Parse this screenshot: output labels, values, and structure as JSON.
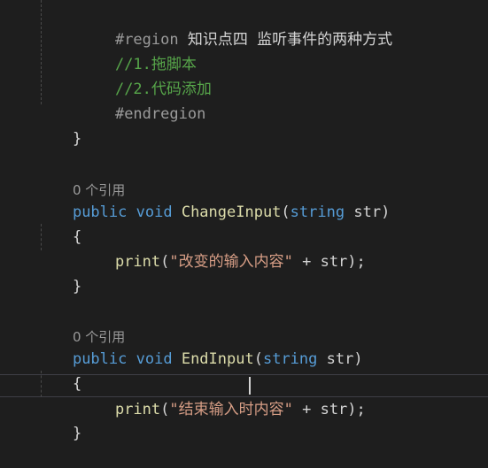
{
  "lines": {
    "region_start": {
      "directive": "#region",
      "title": "知识点四 监听事件的两种方式"
    },
    "comment_1": "//1.拖脚本",
    "comment_2": "//2.代码添加",
    "region_end": "#endregion",
    "close_brace_1": "}",
    "method1": {
      "refs": "0 个引用",
      "kw_public": "public",
      "kw_void": "void",
      "name": "ChangeInput",
      "open_paren": "(",
      "param_type": "string",
      "param_name": "str",
      "close_paren": ")",
      "open_brace": "{",
      "call": "print",
      "call_open": "(",
      "literal": "\"改变的输入内容\"",
      "concat": " + str);",
      "close_brace": "}"
    },
    "method2": {
      "refs": "0 个引用",
      "kw_public": "public",
      "kw_void": "void",
      "name": "EndInput",
      "open_paren": "(",
      "param_type": "string",
      "param_name": "str",
      "close_paren": ")",
      "open_brace": "{",
      "call": "print",
      "call_open": "(",
      "literal": "\"结束输入时内容\"",
      "concat": " + str);",
      "close_brace": "}"
    }
  },
  "colors": {
    "background": "#1e1e1e",
    "keyword": "#569cd6",
    "function": "#dcdcaa",
    "string": "#d69d85",
    "comment": "#57a64a"
  }
}
